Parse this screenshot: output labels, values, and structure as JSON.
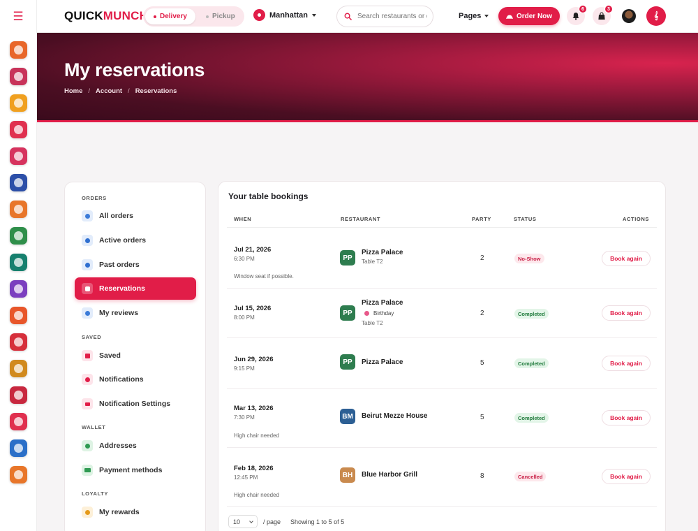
{
  "brand": {
    "name_main": "QUICK",
    "name_accent": "MUNCH."
  },
  "colors": {
    "accent": "#e11d48",
    "hero_dark": "#3a0a1c",
    "green": "#1f7a3b"
  },
  "modes": {
    "delivery": "Delivery",
    "pickup": "Pickup"
  },
  "location": "Manhattan",
  "search": {
    "placeholder": "Search restaurants or dishes"
  },
  "nav_pages": "Pages",
  "order_now": "Order Now",
  "notifications_count": "6",
  "cart_count": "3",
  "rail_icons": [
    "croissant-icon",
    "donut-icon",
    "sushi-icon",
    "cake-icon",
    "plate-icon",
    "wine-icon",
    "cutlery-icon",
    "pizza-icon",
    "sandwich-icon",
    "burger-icon",
    "steak-icon",
    "shrimp-icon",
    "ice-cream-icon",
    "menu-icon",
    "dessert-icon",
    "drink-icon",
    "salad-icon"
  ],
  "hero": {
    "title": "My reservations",
    "breadcrumb": [
      "Home",
      "Account",
      "Reservations"
    ]
  },
  "sidebar": {
    "sections": {
      "orders": "ORDERS",
      "saved": "SAVED",
      "wallet": "WALLET",
      "loyalty": "LOYALTY"
    },
    "items": {
      "all_orders": "All orders",
      "active_orders": "Active orders",
      "past_orders": "Past orders",
      "reservations": "Reservations",
      "my_reviews": "My reviews",
      "saved": "Saved",
      "notifications": "Notifications",
      "notification_settings": "Notification Settings",
      "addresses": "Addresses",
      "payment_methods": "Payment methods",
      "my_rewards": "My rewards"
    }
  },
  "table": {
    "title": "Your table bookings",
    "headers": {
      "when": "WHEN",
      "restaurant": "RESTAURANT",
      "party": "PARTY",
      "status": "STATUS",
      "actions": "ACTIONS"
    },
    "rows": [
      {
        "date": "Jul 21, 2026",
        "time": "6:30 PM",
        "note": "Window seat if possible.",
        "initials": "PP",
        "restaurant": "Pizza Palace",
        "occasion": "",
        "table": "Table T2",
        "party": "2",
        "status": "No-Show",
        "action": "Book again"
      },
      {
        "date": "Jul 15, 2026",
        "time": "8:00 PM",
        "note": "",
        "initials": "PP",
        "restaurant": "Pizza Palace",
        "occasion": "Birthday",
        "table": "Table T2",
        "party": "2",
        "status": "Completed",
        "action": "Book again"
      },
      {
        "date": "Jun 29, 2026",
        "time": "9:15 PM",
        "note": "",
        "initials": "PP",
        "restaurant": "Pizza Palace",
        "occasion": "",
        "table": "",
        "party": "5",
        "status": "Completed",
        "action": "Book again"
      },
      {
        "date": "Mar 13, 2026",
        "time": "7:30 PM",
        "note": "High chair needed",
        "initials": "BM",
        "restaurant": "Beirut Mezze House",
        "occasion": "",
        "table": "",
        "party": "5",
        "status": "Completed",
        "action": "Book again"
      },
      {
        "date": "Feb 18, 2026",
        "time": "12:45 PM",
        "note": "High chair needed",
        "initials": "BH",
        "restaurant": "Blue Harbor Grill",
        "occasion": "",
        "table": "",
        "party": "8",
        "status": "Cancelled",
        "action": "Book again"
      }
    ]
  },
  "pager": {
    "per_page": "10",
    "per_page_label": "/ page",
    "summary": "Showing 1 to 5 of 5"
  }
}
